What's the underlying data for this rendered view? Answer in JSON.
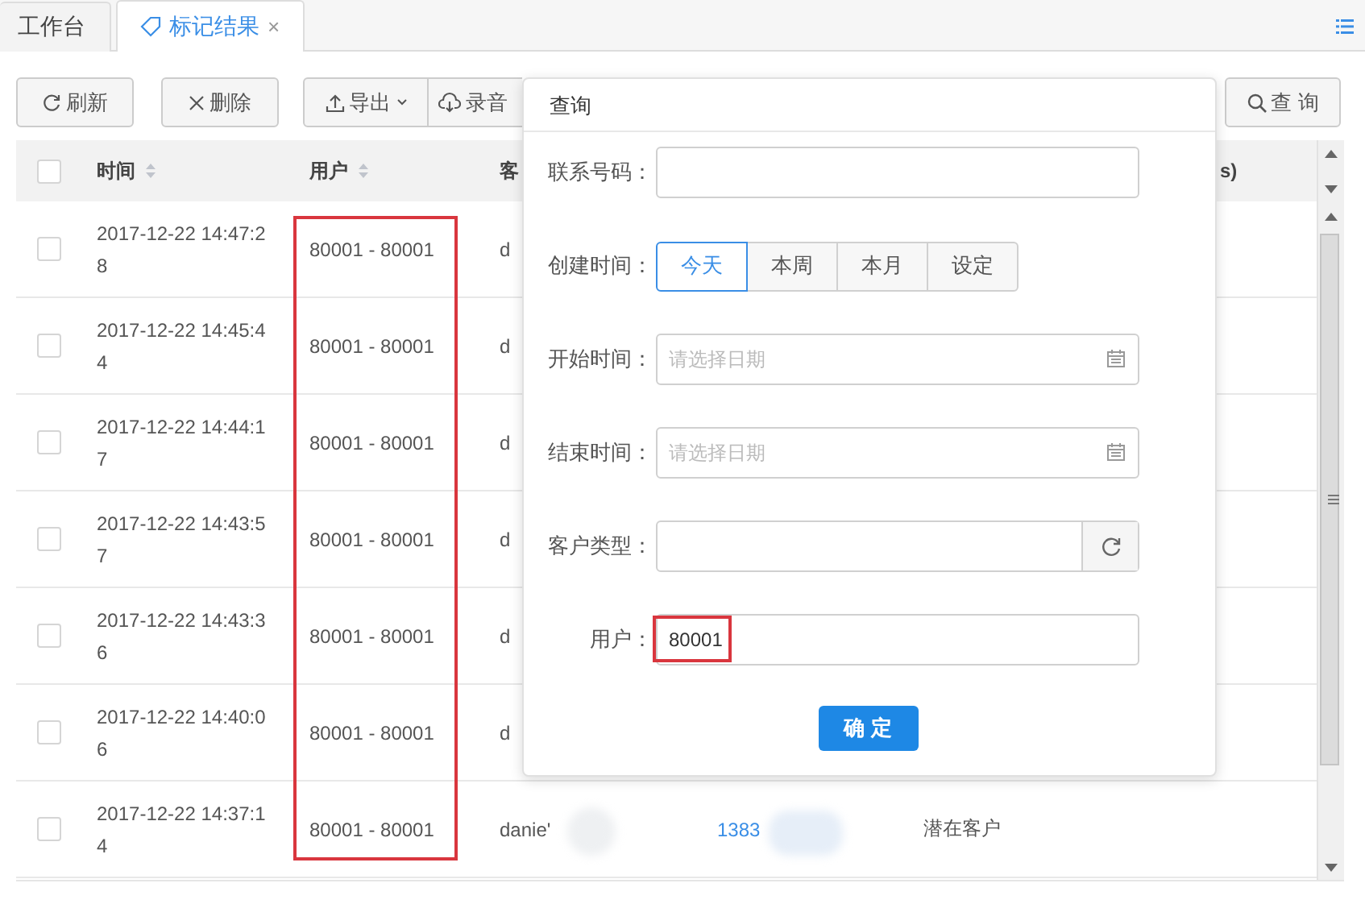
{
  "tabs": [
    {
      "label": "工作台",
      "selected": false
    },
    {
      "label": "标记结果",
      "selected": true,
      "close": "×"
    }
  ],
  "toolbar": {
    "left_buttons": [
      {
        "label": "刷新",
        "kind": "refresh"
      },
      {
        "label": "删除",
        "kind": "delete"
      }
    ],
    "export_group": [
      {
        "label": "导出",
        "kind": "export"
      },
      {
        "label": "录音",
        "kind": "download"
      }
    ],
    "search_button": "查 询"
  },
  "table": {
    "columns": [
      {
        "label": "时间",
        "sortable": true
      },
      {
        "label": "用户",
        "sortable": true
      },
      {
        "label": "客",
        "sortable": false
      },
      {
        "label": "s)",
        "sortable": false
      }
    ],
    "user_column_highlighted": true,
    "header_checked": false,
    "rows": [
      {
        "checked": false,
        "time": "2017-12-22 14:47:28",
        "user": "80001 - 80001",
        "column_3": "d"
      },
      {
        "checked": false,
        "time": "2017-12-22 14:45:44",
        "user": "80001 - 80001",
        "column_3": "d"
      },
      {
        "checked": false,
        "time": "2017-12-22 14:44:17",
        "user": "80001 - 80001",
        "column_3": "d"
      },
      {
        "checked": false,
        "time": "2017-12-22 14:43:57",
        "user": "80001 - 80001",
        "column_3": "d"
      },
      {
        "checked": false,
        "time": "2017-12-22 14:43:36",
        "user": "80001 - 80001",
        "column_3": "d"
      },
      {
        "checked": false,
        "time": "2017-12-22 14:40:06",
        "user": "80001 - 80001",
        "column_3": "d"
      },
      {
        "checked": false,
        "time": "2017-12-22 14:37:14",
        "user": "80001 - 80001",
        "column_3": "danie'",
        "column_4": "1383",
        "column_5": "潜在客户",
        "blurred": true
      }
    ]
  },
  "query_panel": {
    "title": "查询",
    "fields": [
      {
        "kind": "text",
        "label": "联系号码："
      },
      {
        "kind": "segmented",
        "label": "创建时间：",
        "options": [
          {
            "label": "今天",
            "selected": true
          },
          {
            "label": "本周",
            "selected": false
          },
          {
            "label": "本月",
            "selected": false
          },
          {
            "label": "设定",
            "selected": false
          }
        ]
      },
      {
        "kind": "date",
        "label": "开始时间：",
        "placeholder": "请选择日期"
      },
      {
        "kind": "date",
        "label": "结束时间：",
        "placeholder": "请选择日期"
      },
      {
        "kind": "select",
        "label": "客户类型："
      },
      {
        "kind": "text",
        "label": "用户：",
        "value": "80001",
        "highlighted": true
      }
    ],
    "confirm": "确 定"
  }
}
